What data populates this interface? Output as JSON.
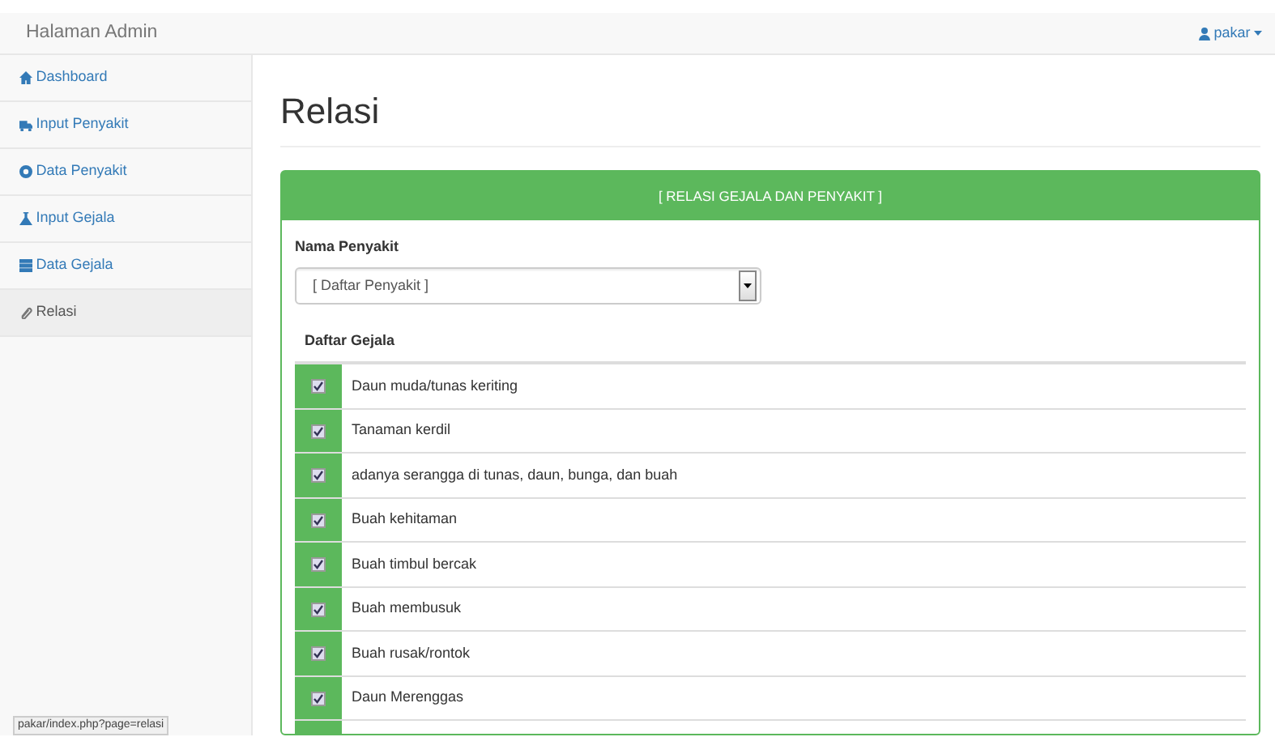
{
  "navbar": {
    "brand": "Halaman Admin",
    "user": "pakar"
  },
  "sidebar": {
    "items": [
      {
        "label": "Dashboard",
        "selected": false
      },
      {
        "label": "Input Penyakit",
        "selected": false
      },
      {
        "label": "Data Penyakit",
        "selected": false
      },
      {
        "label": "Input Gejala",
        "selected": false
      },
      {
        "label": "Data Gejala",
        "selected": false
      },
      {
        "label": "Relasi",
        "selected": true
      }
    ]
  },
  "page": {
    "title": "Relasi"
  },
  "panel": {
    "heading": "[ RELASI GEJALA DAN PENYAKIT ]",
    "field_label": "Nama Penyakit",
    "select": {
      "value": "[ Daftar Penyakit ]"
    },
    "list_title": "Daftar Gejala",
    "symptoms": [
      {
        "label": "Daun muda/tunas keriting",
        "checked": true
      },
      {
        "label": "Tanaman kerdil",
        "checked": true
      },
      {
        "label": "adanya serangga di tunas, daun, bunga, dan buah",
        "checked": true
      },
      {
        "label": "Buah kehitaman",
        "checked": true
      },
      {
        "label": "Buah timbul bercak",
        "checked": true
      },
      {
        "label": "Buah membusuk",
        "checked": true
      },
      {
        "label": "Buah rusak/rontok",
        "checked": true
      },
      {
        "label": "Daun Merenggas",
        "checked": true
      }
    ]
  },
  "status_bar": {
    "url": "pakar/index.php?page=relasi"
  }
}
